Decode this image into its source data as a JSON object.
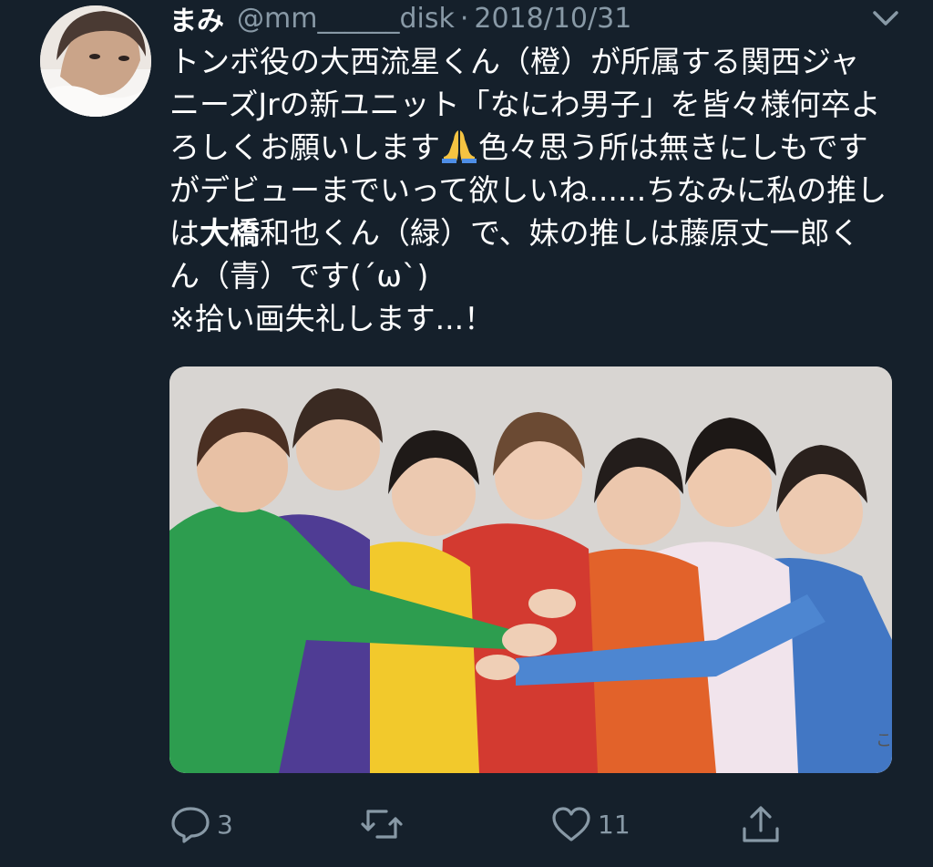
{
  "tweet": {
    "display_name": "まみ",
    "handle": "@mm______disk",
    "separator": "·",
    "date": "2018/10/31",
    "text_lines": [
      "トンボ役の大西流星くん（橙）が所属する関西ジャ",
      "ニーズJrの新ユニット「なにわ男子」を皆々様何卒よ",
      "ろしくお願いします",
      "色々思う所は無きにしもです",
      "がデビューまでいって欲しいね......ちなみに私の推し",
      "は",
      "大橋",
      "和也くん（緑）で、妹の推しは藤原丈一郎く",
      "ん（青）です(´ω`)",
      "※拾い画失礼します...！"
    ],
    "emoji": "folded-hands-icon"
  },
  "actions": {
    "reply_count": "3",
    "retweet_count": "",
    "like_count": "11"
  },
  "icons": {
    "reply": "reply-icon",
    "retweet": "retweet-icon",
    "like": "heart-icon",
    "share": "share-icon",
    "menu": "chevron-down-icon"
  },
  "colors": {
    "background": "#15202b",
    "secondary_text": "#8899a6",
    "primary_text": "#ffffff"
  },
  "media": {
    "corner_text": "こ"
  }
}
